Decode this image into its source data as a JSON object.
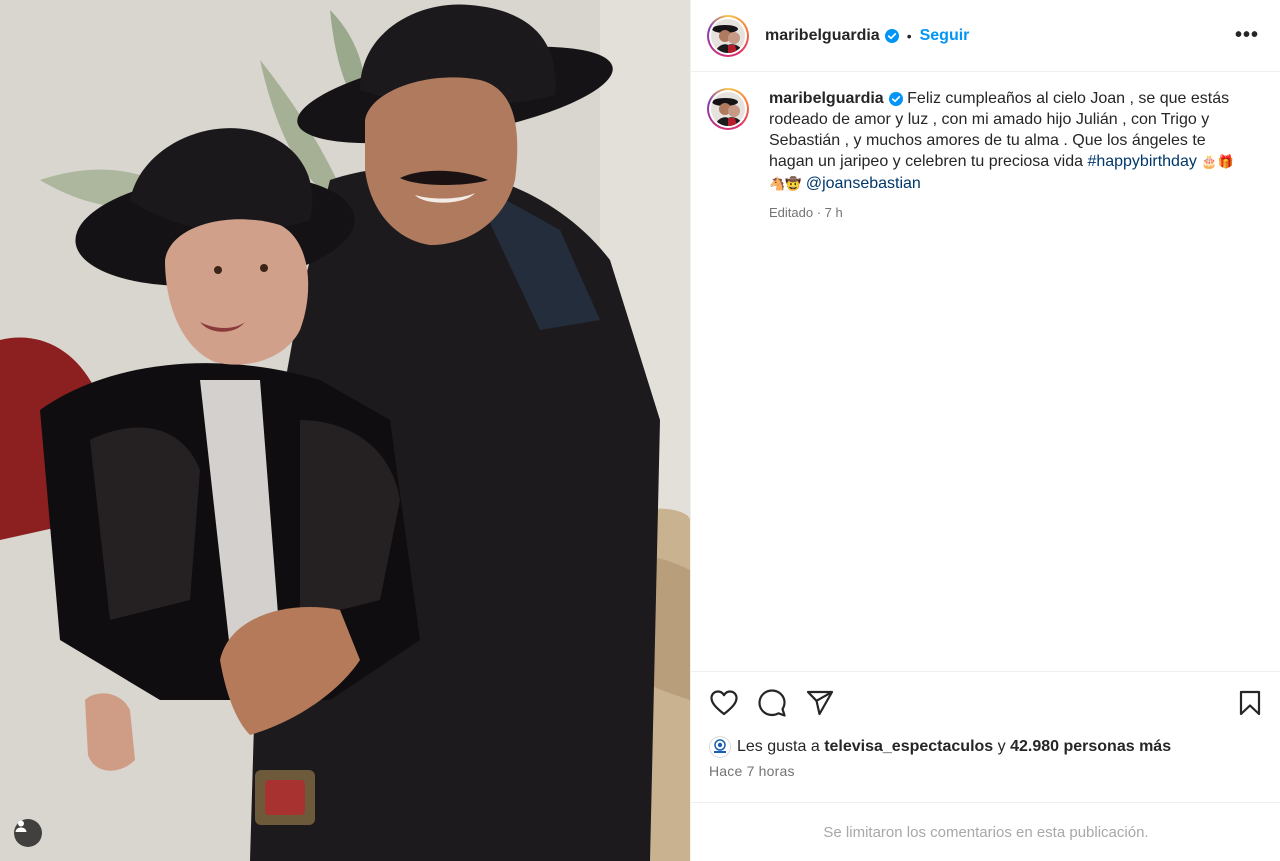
{
  "post": {
    "username": "maribelguardia",
    "follow_label": "Seguir",
    "separator": "•",
    "more_label": "•••",
    "caption": {
      "username": "maribelguardia",
      "text": "Feliz cumpleaños al cielo Joan , se que estás rodeado de amor y luz , con mi amado hijo Julián , con Trigo y Sebastián , y muchos amores de tu alma . Que los ángeles te hagan un jaripeo y celebren tu preciosa vida",
      "hashtag": "#happybirthday",
      "emojis": "🎂🎁🐴🤠",
      "mention": "@joansebastian",
      "edited": "Editado · 7 h"
    },
    "likes": {
      "prefix": "Les gusta a",
      "user": "televisa_espectaculos",
      "connector": "y",
      "others": "42.980 personas más"
    },
    "time_ago": "Hace 7 horas",
    "comments_notice": "Se limitaron los comentarios en esta publicación."
  },
  "icons": [
    "heart-icon",
    "comment-icon",
    "share-icon",
    "bookmark-icon",
    "verified-icon",
    "user-tag-icon",
    "more-icon"
  ],
  "colors": {
    "link": "#0095f6",
    "hashtag": "#00376b",
    "muted": "#737373",
    "border": "#efefef"
  }
}
